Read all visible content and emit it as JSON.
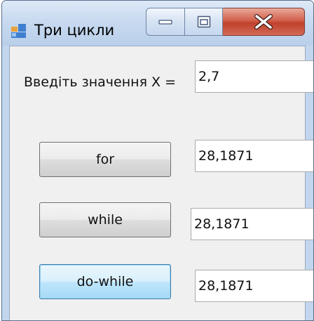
{
  "window": {
    "title": "Три цикли",
    "icons": {
      "app": "app-window-icon",
      "minimize": "minimize-icon",
      "maximize": "maximize-icon",
      "close": "close-icon"
    },
    "colors": {
      "close_button": "#c8452f",
      "focused_button_border": "#3c7fb1"
    }
  },
  "form": {
    "x_label": "Введіть значення X =",
    "x_value": "2,7",
    "for_button": "for",
    "for_result": "28,1871",
    "while_button": "while",
    "while_result": "28,1871",
    "dowhile_button": "do-while",
    "dowhile_result": "28,1871",
    "focused_button": "do-while"
  }
}
